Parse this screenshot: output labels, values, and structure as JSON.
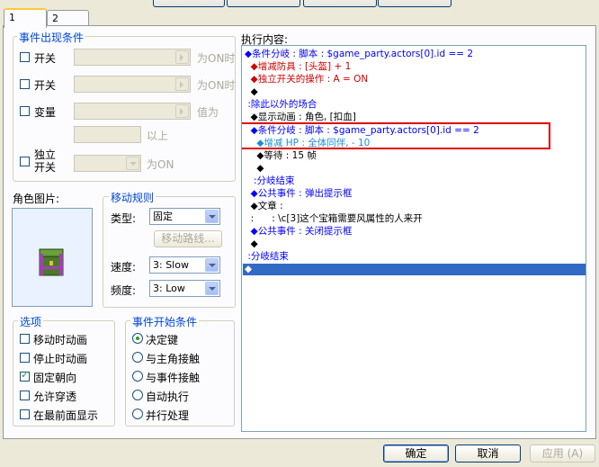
{
  "tabs": [
    {
      "label": "1"
    },
    {
      "label": "2"
    }
  ],
  "conditions": {
    "title": "事件出现条件",
    "switch1": {
      "label": "开关",
      "suffix": "为ON时"
    },
    "switch2": {
      "label": "开关",
      "suffix": "为ON时"
    },
    "variable": {
      "label": "变量",
      "suffix": "值为",
      "suffix2": "以上"
    },
    "selfswitch": {
      "label_line1": "独立",
      "label_line2": "开关",
      "suffix": "为ON"
    }
  },
  "graphic": {
    "title": "角色图片:"
  },
  "movement": {
    "title": "移动规则",
    "type_label": "类型:",
    "type_value": "固定",
    "route_button": "移动路线...",
    "speed_label": "速度:",
    "speed_value": "3: Slow",
    "freq_label": "频度:",
    "freq_value": "3: Low"
  },
  "options": {
    "title": "选项",
    "items": [
      {
        "label": "移动时动画",
        "checked": false
      },
      {
        "label": "停止时动画",
        "checked": false
      },
      {
        "label": "固定朝向",
        "checked": true
      },
      {
        "label": "允许穿透",
        "checked": false
      },
      {
        "label": "在最前面显示",
        "checked": false
      }
    ]
  },
  "trigger": {
    "title": "事件开始条件",
    "items": [
      {
        "label": "决定键",
        "selected": true
      },
      {
        "label": "与主角接触",
        "selected": false
      },
      {
        "label": "与事件接触",
        "selected": false
      },
      {
        "label": "自动执行",
        "selected": false
      },
      {
        "label": "并行处理",
        "selected": false
      }
    ]
  },
  "contents": {
    "title": "执行内容:",
    "lines": [
      "◆条件分岐 : 脚本 : $game_party.actors[0].id == 2",
      "  ◆增减防具 : [头盔] + 1",
      "  ◆独立开关的操作 : A = ON",
      "  ◆",
      " :除此以外的场合",
      "  ◆显示动画 : 角色, [扣血]",
      "  ◆条件分岐 : 脚本 : $game_party.actors[0].id == 2",
      "    ◆增减 HP : 全体同伴, - 10",
      "    ◆等待 : 15 帧",
      "    ◆",
      "   :分岐结束",
      "  ◆公共事件 : 弹出提示框",
      "  ◆文章 : ",
      "  :      : \\c[3]这个宝箱需要风属性的人来开",
      "  ◆公共事件 : 关闭提示框",
      "  ◆",
      " :分岐结束",
      "◆"
    ],
    "highlight_color": "#e00000",
    "selection_color": "#316ac5"
  },
  "footer": {
    "ok": "确定",
    "cancel": "取消",
    "apply": "应用 (A)"
  }
}
